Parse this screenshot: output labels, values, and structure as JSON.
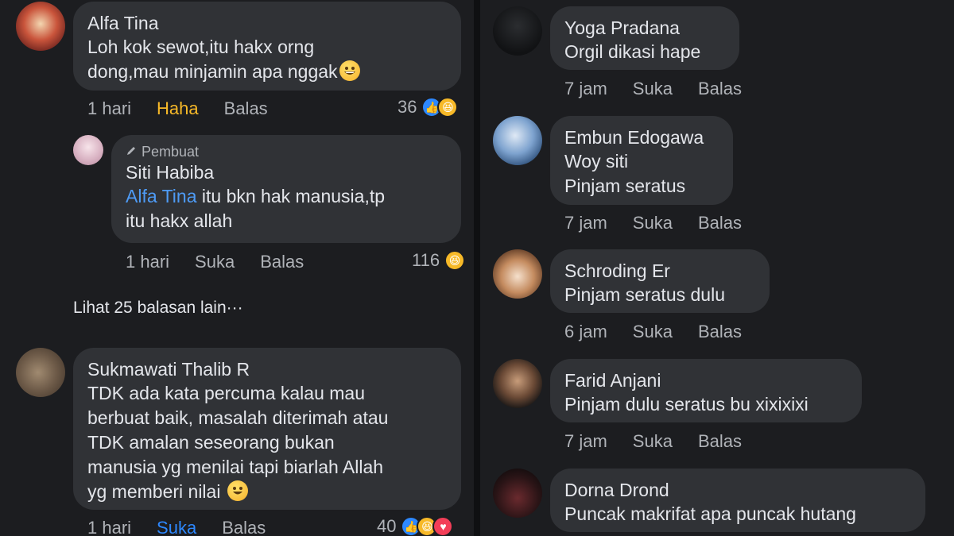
{
  "left": {
    "comments": [
      {
        "name": "Alfa Tina",
        "lines": [
          "Loh kok sewot,itu hakx orng",
          "dong,mau minjamin apa nggak"
        ],
        "time": "1 hari",
        "reaction_label": "Haha",
        "reply_label": "Balas",
        "count": "36"
      },
      {
        "author_tag": "Pembuat",
        "name": "Siti Habiba",
        "mention": "Alfa Tina",
        "line1_rest": " itu bkn hak manusia,tp",
        "line2": "itu hakx allah",
        "time": "1 hari",
        "like_label": "Suka",
        "reply_label": "Balas",
        "count": "116"
      },
      {
        "name": "Sukmawati Thalib R",
        "lines": [
          "TDK ada kata percuma kalau mau",
          "berbuat baik, masalah diterimah atau",
          "TDK amalan seseorang bukan",
          "manusia yg menilai tapi biarlah Allah",
          "yg memberi nilai"
        ],
        "time": "1 hari",
        "like_label": "Suka",
        "reply_label": "Balas",
        "count": "40"
      }
    ],
    "more_replies": "Lihat 25 balasan lain···"
  },
  "right": {
    "comments": [
      {
        "name": "Yoga Pradana",
        "lines": [
          "Orgil dikasi hape"
        ],
        "time": "7 jam",
        "like_label": "Suka",
        "reply_label": "Balas"
      },
      {
        "name": "Embun Edogawa",
        "lines": [
          "Woy siti",
          "Pinjam seratus"
        ],
        "time": "7 jam",
        "like_label": "Suka",
        "reply_label": "Balas"
      },
      {
        "name": "Schroding Er",
        "lines": [
          "Pinjam seratus dulu"
        ],
        "time": "6 jam",
        "like_label": "Suka",
        "reply_label": "Balas"
      },
      {
        "name": "Farid Anjani",
        "lines": [
          "Pinjam dulu seratus bu xixixixi"
        ],
        "time": "7 jam",
        "like_label": "Suka",
        "reply_label": "Balas"
      },
      {
        "name": "Dorna Drond",
        "lines": [
          "Puncak makrifat apa puncak hutang"
        ]
      }
    ]
  },
  "colors": {
    "background": "#1c1d20",
    "bubble": "#303236",
    "text": "#e4e6eb",
    "muted": "#b0b3b8",
    "link": "#4e9bf5",
    "haha": "#f7b928",
    "like": "#2d88ff"
  },
  "icons": [
    "pencil-icon",
    "like-reaction-icon",
    "haha-reaction-icon",
    "love-reaction-icon",
    "grin-emoji-icon",
    "smile-emoji-icon"
  ]
}
